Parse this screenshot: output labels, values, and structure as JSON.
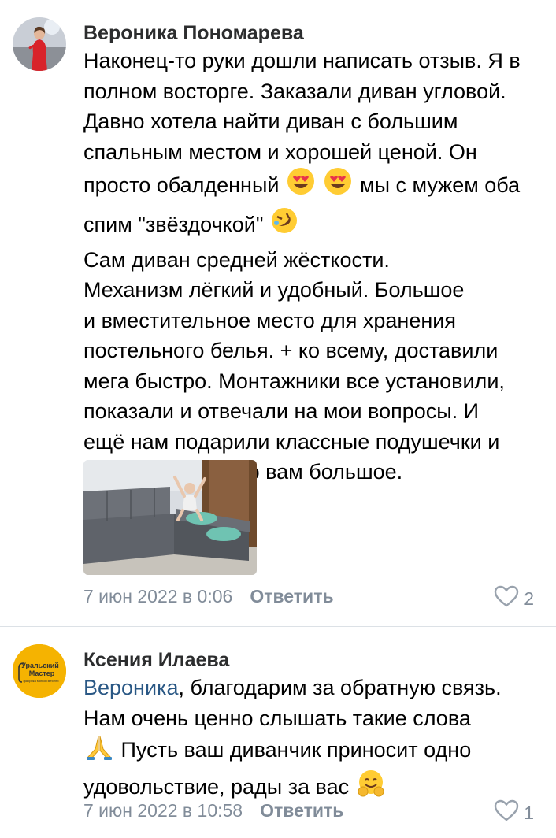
{
  "comments": [
    {
      "author": "Вероника Пономарева",
      "text_lines": [
        "Наконец-то руки дошли написать отзыв. Я в",
        "полном восторге. Заказали диван угловой.",
        "Давно хотела найти диван с большим",
        "спальным местом и хорошей ценой. Он",
        "просто обалденный",
        "мы с мужем оба",
        "спим \"звёздочкой\"",
        "Сам диван средней жёсткости.",
        "Механизм лёгкий и удобный. Большое",
        "и вместительное место для хранения",
        "постельного белья. + ко всему, доставили",
        "мега быстро. Монтажники все установили,",
        "показали и отвечали на мои вопросы. И",
        "ещё нам подарили классные подушечки и",
        "пуф-куб. Спасибо вам большое."
      ],
      "date": "7 июн 2022 в 0:06",
      "reply_label": "Ответить",
      "likes": "2"
    },
    {
      "author": "Ксения Илаева",
      "mention": "Вероника",
      "text_lines": [
        ", благодарим за обратную связь.",
        "Нам очень ценно слышать такие слова",
        "Пусть ваш диванчик приносит одно",
        "удовольствие, рады за вас"
      ],
      "date": "7 июн 2022 в 10:58",
      "reply_label": "Ответить",
      "likes": "1"
    }
  ],
  "brand_logo": {
    "line1": "Уральский",
    "line2": "Мастер",
    "line3": "фабрика мягкой мебели"
  },
  "icons": {
    "heart": "heart-outline-icon",
    "heart_eyes": "heart-eyes-emoji",
    "rofl": "rolling-laughing-emoji",
    "pray": "folded-hands-emoji",
    "hug": "hugging-face-emoji"
  },
  "colors": {
    "mention": "#2a5885",
    "meta": "#818c99",
    "logo_bg": "#f5b301"
  }
}
